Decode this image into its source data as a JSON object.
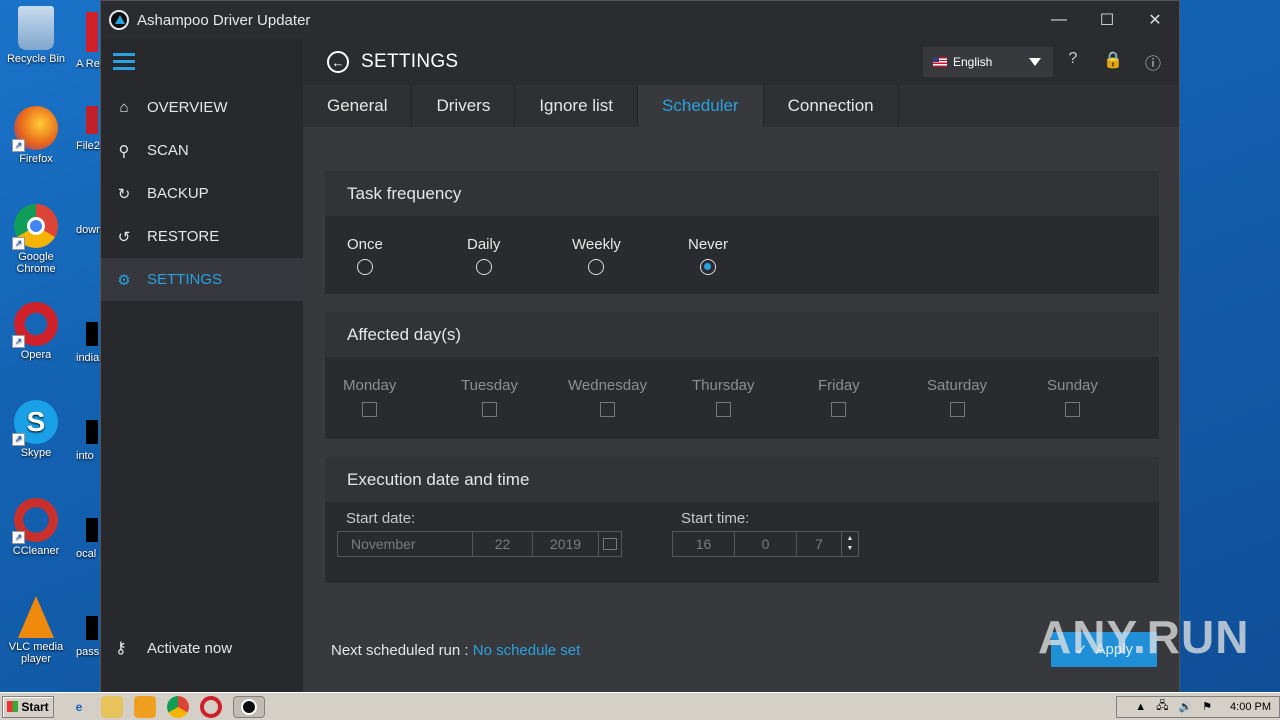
{
  "desktop": {
    "icons": [
      {
        "label": "Recycle Bin",
        "color": "#8fb6da"
      },
      {
        "label": "Firefox",
        "color": "#e8661c"
      },
      {
        "label": "Google Chrome",
        "color": "#2d9a4a"
      },
      {
        "label": "Opera",
        "color": "#d0202a"
      },
      {
        "label": "Skype",
        "color": "#1aa0e6"
      },
      {
        "label": "CCleaner",
        "color": "#c9302c"
      },
      {
        "label": "VLC media player",
        "color": "#f08a0c"
      }
    ],
    "partial_labels": [
      "A Re",
      "File2",
      "down",
      "india",
      "into",
      "ocal",
      "pass"
    ]
  },
  "window": {
    "title": "Ashampoo Driver Updater",
    "controls": {
      "minimize": "—",
      "maximize": "☐",
      "close": "✕"
    }
  },
  "sidebar": {
    "items": [
      {
        "label": "OVERVIEW",
        "icon": "home-icon",
        "glyph": "⌂",
        "active": false
      },
      {
        "label": "SCAN",
        "icon": "magnifier-icon",
        "glyph": "⚲",
        "active": false
      },
      {
        "label": "BACKUP",
        "icon": "backup-icon",
        "glyph": "↻",
        "active": false
      },
      {
        "label": "RESTORE",
        "icon": "restore-icon",
        "glyph": "↺",
        "active": false
      },
      {
        "label": "SETTINGS",
        "icon": "gear-icon",
        "glyph": "⚙",
        "active": true
      }
    ],
    "activate_label": "Activate now",
    "activate_glyph": "⚷"
  },
  "header": {
    "title": "SETTINGS",
    "back_glyph": "←",
    "language": "English",
    "help_glyph": "?",
    "lock_glyph": "🔒",
    "info_glyph": "ⓘ"
  },
  "tabs": [
    {
      "label": "General",
      "active": false
    },
    {
      "label": "Drivers",
      "active": false
    },
    {
      "label": "Ignore list",
      "active": false
    },
    {
      "label": "Scheduler",
      "active": true
    },
    {
      "label": "Connection",
      "active": false
    }
  ],
  "task_frequency": {
    "heading": "Task frequency",
    "options": [
      {
        "label": "Once",
        "checked": false
      },
      {
        "label": "Daily",
        "checked": false
      },
      {
        "label": "Weekly",
        "checked": false
      },
      {
        "label": "Never",
        "checked": true
      }
    ]
  },
  "affected_days": {
    "heading": "Affected day(s)",
    "days": [
      "Monday",
      "Tuesday",
      "Wednesday",
      "Thursday",
      "Friday",
      "Saturday",
      "Sunday"
    ]
  },
  "execution": {
    "heading": "Execution date and time",
    "start_date_label": "Start date:",
    "month": "November",
    "day": "22",
    "year": "2019",
    "start_time_label": "Start time:",
    "hour": "16",
    "minute": "0",
    "second": "7"
  },
  "footer": {
    "next_run_label": "Next scheduled run :",
    "next_run_value": "No schedule set",
    "apply_label": "Apply",
    "apply_glyph": "✓"
  },
  "watermark": "ANY.RUN",
  "taskbar": {
    "start_label": "Start",
    "clock": "4:00 PM",
    "tray_glyphs": [
      "▲",
      "🖧",
      "🔊",
      "⚑"
    ]
  },
  "colors": {
    "accent": "#2aa1e0",
    "window_bg": "#303236",
    "panel_bg": "#2a2b2f"
  }
}
